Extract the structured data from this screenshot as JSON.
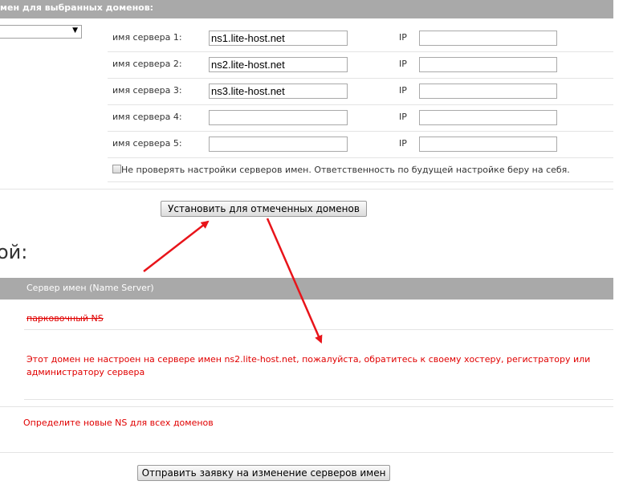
{
  "top_bar": {
    "title": "мен для выбранных доменов:"
  },
  "servers": [
    {
      "label": "имя сервера 1:",
      "value": "ns1.lite-host.net",
      "ip_label": "IP",
      "ip_value": ""
    },
    {
      "label": "имя сервера 2:",
      "value": "ns2.lite-host.net",
      "ip_label": "IP",
      "ip_value": ""
    },
    {
      "label": "имя сервера 3:",
      "value": "ns3.lite-host.net",
      "ip_label": "IP",
      "ip_value": ""
    },
    {
      "label": "имя сервера 4:",
      "value": "",
      "ip_label": "IP",
      "ip_value": ""
    },
    {
      "label": "имя сервера 5:",
      "value": "",
      "ip_label": "IP",
      "ip_value": ""
    }
  ],
  "skip_check": {
    "label": "Не проверять настройки серверов имен. Ответственность по будущей настройке беру на себя."
  },
  "apply_button": "Установить для отмеченных доменов",
  "section_heading": "ой:",
  "table": {
    "header": "Сервер имен (Name Server)",
    "parking_ns": "парковочный NS",
    "warning": "Этот домен не настроен на сервере имен ns2.lite-host.net, пожалуйста, обратитесь к своему хостеру, регистратору или администратору сервера"
  },
  "define_ns_text": "Определите новые NS для всех доменов",
  "submit_button": "Отправить заявку на изменение серверов имен",
  "colors": {
    "annotation_arrow": "#e8141a",
    "header_gray": "#a9a9a9",
    "error_red": "#e00000"
  }
}
